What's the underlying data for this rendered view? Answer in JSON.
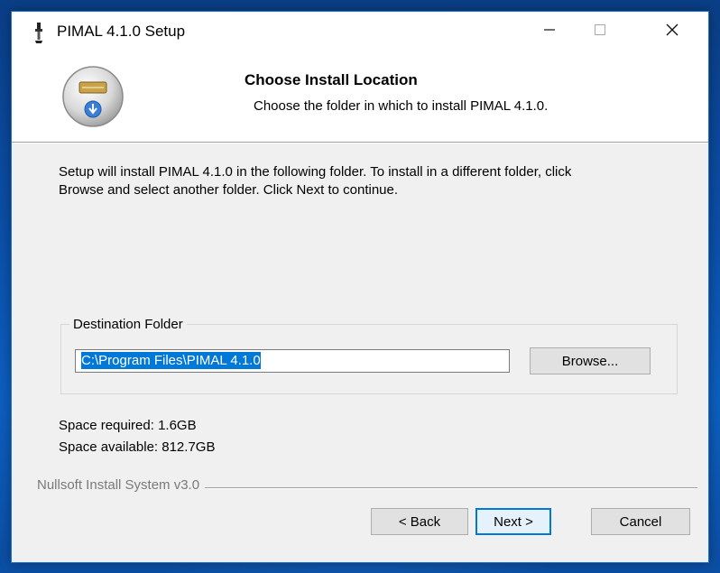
{
  "window": {
    "title": "PIMAL 4.1.0 Setup",
    "controls": {
      "minimize_icon": "minimize-icon",
      "maximize_icon": "maximize-icon",
      "close_icon": "close-icon"
    }
  },
  "header": {
    "title": "Choose Install Location",
    "subtitle": "Choose the folder in which to install PIMAL 4.1.0."
  },
  "body": {
    "intro_line1": "Setup will install PIMAL 4.1.0 in the following folder. To install in a different folder, click",
    "intro_line2": "Browse and select another folder. Click Next to continue.",
    "destination": {
      "label": "Destination Folder",
      "path_value": "C:\\Program Files\\PIMAL 4.1.0",
      "browse_label": "Browse..."
    },
    "space_required": "Space required: 1.6GB",
    "space_available": "Space available: 812.7GB"
  },
  "footer": {
    "branding": "Nullsoft Install System v3.0",
    "back_label": "< Back",
    "next_label": "Next >",
    "cancel_label": "Cancel"
  },
  "colors": {
    "accent": "#0078d7",
    "desktop": "#0b4fa8",
    "dialog_bg": "#f0f0f0"
  }
}
